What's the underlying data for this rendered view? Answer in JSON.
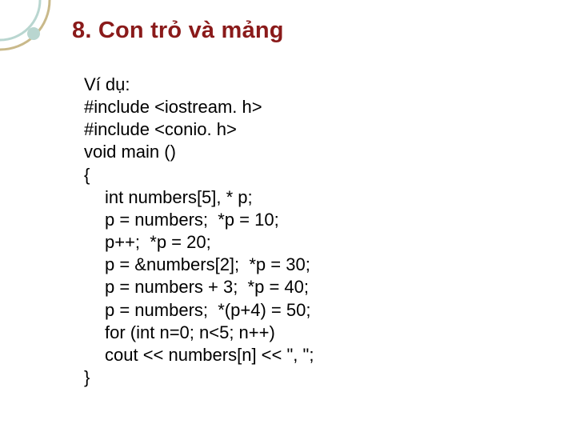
{
  "title": "8. Con trỏ và mảng",
  "example_label": "Ví dụ:",
  "code": {
    "l1": "#include <iostream. h>",
    "l2": "#include <conio. h>",
    "l3": "void main ()",
    "l4": "{",
    "l5": "int numbers[5], * p;",
    "l6": "p = numbers;  *p = 10;",
    "l7": "p++;  *p = 20;",
    "l8": "p = &numbers[2];  *p = 30;",
    "l9": "p = numbers + 3;  *p = 40;",
    "l10": "p = numbers;  *(p+4) = 50;",
    "l11": "for (int n=0; n<5; n++)",
    "l12": "cout << numbers[n] << \", \";",
    "l13": "}"
  }
}
